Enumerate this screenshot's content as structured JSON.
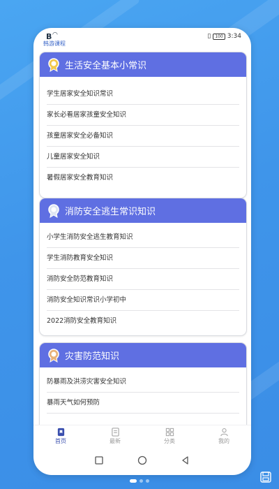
{
  "status": {
    "brand": "韩游课程",
    "time": "3:34",
    "battery": "100"
  },
  "sections": [
    {
      "title": "生活安全基本小常识",
      "items": [
        "学生居家安全知识常识",
        "家长必看居家孩童安全知识",
        "孩童居家安全必备知识",
        "儿童居家安全知识",
        "暑假居家安全教育知识"
      ]
    },
    {
      "title": "消防安全逃生常识知识",
      "items": [
        "小学生消防安全逃生教育知识",
        "学生消防教育安全知识",
        "消防安全防范教育知识",
        "消防安全知识常识小学初中",
        "2022消防安全教育知识"
      ]
    },
    {
      "title": "灾害防范知识",
      "items": [
        "防暴雨及洪涝灾害安全知识",
        "暴雨天气如何预防"
      ]
    }
  ],
  "tabs": [
    {
      "label": "首页",
      "icon": "home-icon",
      "active": true
    },
    {
      "label": "最新",
      "icon": "document-icon",
      "active": false
    },
    {
      "label": "分类",
      "icon": "grid-icon",
      "active": false
    },
    {
      "label": "我的",
      "icon": "person-icon",
      "active": false
    }
  ],
  "colors": {
    "accent": "#5f6fe2",
    "background": "#3f95ea",
    "active_tab": "#3a4fae"
  }
}
